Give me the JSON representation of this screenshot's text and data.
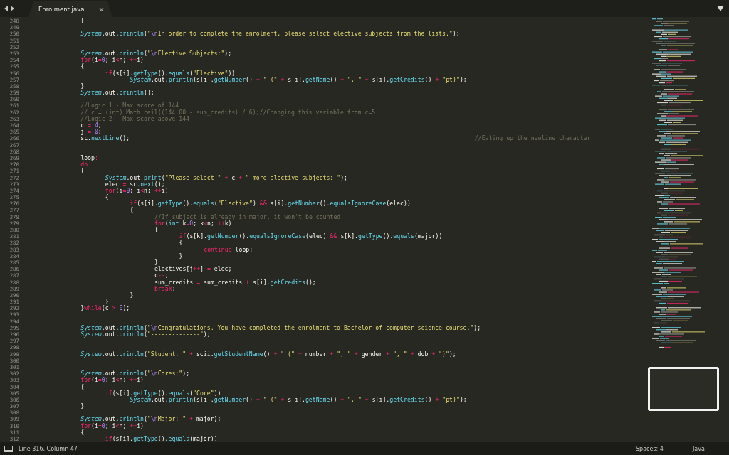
{
  "tab": {
    "title": "Enrolment.java",
    "selected": true
  },
  "lines": [
    {
      "number": "248",
      "tokens": [
        {
          "kind": "txt",
          "text": "\t\t\t\t}"
        }
      ]
    },
    {
      "number": "249"
    },
    {
      "number": "250",
      "tokens": [
        {
          "kind": "cls",
          "text": "\t\t\t\tSystem"
        },
        {
          "kind": "txt",
          "text": ".out."
        },
        {
          "kind": "fn",
          "text": "println"
        },
        {
          "kind": "txt",
          "text": "("
        },
        {
          "kind": "str",
          "text": "\""
        },
        {
          "kind": "esc",
          "text": "\\n"
        },
        {
          "kind": "str",
          "text": "In order to complete the enrolment, please select elective subjects from the lists.\""
        },
        {
          "kind": "txt",
          "text": ");"
        }
      ]
    },
    {
      "number": "251"
    },
    {
      "number": "252"
    },
    {
      "number": "253",
      "tokens": [
        {
          "kind": "cls",
          "text": "\t\t\t\tSystem"
        },
        {
          "kind": "txt",
          "text": ".out."
        },
        {
          "kind": "fn",
          "text": "println"
        },
        {
          "kind": "txt",
          "text": "("
        },
        {
          "kind": "str",
          "text": "\""
        },
        {
          "kind": "esc",
          "text": "\\n"
        },
        {
          "kind": "str",
          "text": "Elective Subjects:\""
        },
        {
          "kind": "txt",
          "text": ");"
        }
      ]
    },
    {
      "number": "254",
      "tokens": [
        {
          "kind": "kw",
          "text": "\t\t\t\tfor"
        },
        {
          "kind": "txt",
          "text": "(i"
        },
        {
          "kind": "kw",
          "text": "="
        },
        {
          "kind": "num",
          "text": "0"
        },
        {
          "kind": "txt",
          "text": "; i"
        },
        {
          "kind": "kw",
          "text": "<"
        },
        {
          "kind": "txt",
          "text": "n; "
        },
        {
          "kind": "kw",
          "text": "++"
        },
        {
          "kind": "txt",
          "text": "i)"
        }
      ]
    },
    {
      "number": "255",
      "tokens": [
        {
          "kind": "txt",
          "text": "\t\t\t\t{"
        }
      ]
    },
    {
      "number": "256",
      "tokens": [
        {
          "kind": "kw",
          "text": "\t\t\t\t\t\tif"
        },
        {
          "kind": "txt",
          "text": "(s[i]."
        },
        {
          "kind": "fn",
          "text": "getType"
        },
        {
          "kind": "txt",
          "text": "()."
        },
        {
          "kind": "fn",
          "text": "equals"
        },
        {
          "kind": "txt",
          "text": "("
        },
        {
          "kind": "str",
          "text": "\"Elective\""
        },
        {
          "kind": "txt",
          "text": "))"
        }
      ]
    },
    {
      "number": "257",
      "tokens": [
        {
          "kind": "cls",
          "text": "\t\t\t\t\t\t\t\tSystem"
        },
        {
          "kind": "txt",
          "text": ".out."
        },
        {
          "kind": "fn",
          "text": "println"
        },
        {
          "kind": "txt",
          "text": "(s[i]."
        },
        {
          "kind": "fn",
          "text": "getNumber"
        },
        {
          "kind": "txt",
          "text": "() "
        },
        {
          "kind": "kw",
          "text": "+"
        },
        {
          "kind": "str",
          "text": " \" (\" "
        },
        {
          "kind": "kw",
          "text": "+"
        },
        {
          "kind": "txt",
          "text": " s[i]."
        },
        {
          "kind": "fn",
          "text": "getName"
        },
        {
          "kind": "txt",
          "text": "() "
        },
        {
          "kind": "kw",
          "text": "+"
        },
        {
          "kind": "str",
          "text": " \", \" "
        },
        {
          "kind": "kw",
          "text": "+"
        },
        {
          "kind": "txt",
          "text": " s[i]."
        },
        {
          "kind": "fn",
          "text": "getCredits"
        },
        {
          "kind": "txt",
          "text": "() "
        },
        {
          "kind": "kw",
          "text": "+"
        },
        {
          "kind": "str",
          "text": " \"pt)\""
        },
        {
          "kind": "txt",
          "text": ");"
        }
      ]
    },
    {
      "number": "258",
      "tokens": [
        {
          "kind": "txt",
          "text": "\t\t\t\t}"
        }
      ]
    },
    {
      "number": "259",
      "tokens": [
        {
          "kind": "cls",
          "text": "\t\t\t\tSystem"
        },
        {
          "kind": "txt",
          "text": ".out."
        },
        {
          "kind": "fn",
          "text": "println"
        },
        {
          "kind": "txt",
          "text": "();"
        }
      ]
    },
    {
      "number": "260"
    },
    {
      "number": "261",
      "tokens": [
        {
          "kind": "cmt",
          "text": "\t\t\t\t//Logic 1 - Max score of 144"
        }
      ]
    },
    {
      "number": "262",
      "tokens": [
        {
          "kind": "cmt",
          "text": "\t\t\t\t// c = (int) Math.ceil((144.00 - sum_credits) / 6);//Changing this variable from c=5"
        }
      ]
    },
    {
      "number": "263",
      "tokens": [
        {
          "kind": "cmt",
          "text": "\t\t\t\t//Logic 2 - Max score above 144"
        }
      ]
    },
    {
      "number": "264",
      "tokens": [
        {
          "kind": "txt",
          "text": "\t\t\t\tc "
        },
        {
          "kind": "kw",
          "text": "="
        },
        {
          "kind": "num",
          "text": " 4"
        },
        {
          "kind": "txt",
          "text": ";"
        }
      ]
    },
    {
      "number": "265",
      "tokens": [
        {
          "kind": "txt",
          "text": "\t\t\t\tj "
        },
        {
          "kind": "kw",
          "text": "="
        },
        {
          "kind": "num",
          "text": " 0"
        },
        {
          "kind": "txt",
          "text": ";"
        }
      ]
    },
    {
      "number": "266",
      "tokens": [
        {
          "kind": "txt",
          "text": "\t\t\t\tsc."
        },
        {
          "kind": "fn",
          "text": "nextLine"
        },
        {
          "kind": "txt",
          "text": "();\t\t\t\t\t\t\t\t\t\t\t\t\t\t\t\t\t\t\t\t\t\t\t\t\t\t\t\t"
        },
        {
          "kind": "cmt",
          "text": "//Eating up the newline character"
        }
      ]
    },
    {
      "number": "267"
    },
    {
      "number": "268"
    },
    {
      "number": "269",
      "tokens": [
        {
          "kind": "txt",
          "text": "\t\t\t\tloop"
        },
        {
          "kind": "kw",
          "text": ":"
        }
      ]
    },
    {
      "number": "270",
      "tokens": [
        {
          "kind": "kw",
          "text": "\t\t\t\tdo"
        }
      ]
    },
    {
      "number": "271",
      "tokens": [
        {
          "kind": "txt",
          "text": "\t\t\t\t{"
        }
      ]
    },
    {
      "number": "272",
      "tokens": [
        {
          "kind": "cls",
          "text": "\t\t\t\t\t\tSystem"
        },
        {
          "kind": "txt",
          "text": ".out."
        },
        {
          "kind": "fn",
          "text": "print"
        },
        {
          "kind": "txt",
          "text": "("
        },
        {
          "kind": "str",
          "text": "\"Please select \" "
        },
        {
          "kind": "kw",
          "text": "+"
        },
        {
          "kind": "txt",
          "text": " c "
        },
        {
          "kind": "kw",
          "text": "+"
        },
        {
          "kind": "str",
          "text": " \" more elective subjects: \""
        },
        {
          "kind": "txt",
          "text": ");"
        }
      ]
    },
    {
      "number": "273",
      "tokens": [
        {
          "kind": "txt",
          "text": "\t\t\t\t\t\telec "
        },
        {
          "kind": "kw",
          "text": "="
        },
        {
          "kind": "txt",
          "text": " sc."
        },
        {
          "kind": "fn",
          "text": "next"
        },
        {
          "kind": "txt",
          "text": "();"
        }
      ]
    },
    {
      "number": "274",
      "tokens": [
        {
          "kind": "kw",
          "text": "\t\t\t\t\t\tfor"
        },
        {
          "kind": "txt",
          "text": "(i"
        },
        {
          "kind": "kw",
          "text": "="
        },
        {
          "kind": "num",
          "text": "0"
        },
        {
          "kind": "txt",
          "text": "; i"
        },
        {
          "kind": "kw",
          "text": "<"
        },
        {
          "kind": "txt",
          "text": "n; "
        },
        {
          "kind": "kw",
          "text": "++"
        },
        {
          "kind": "txt",
          "text": "i)"
        }
      ]
    },
    {
      "number": "275",
      "tokens": [
        {
          "kind": "txt",
          "text": "\t\t\t\t\t\t{"
        }
      ]
    },
    {
      "number": "276",
      "tokens": [
        {
          "kind": "kw",
          "text": "\t\t\t\t\t\t\t\tif"
        },
        {
          "kind": "txt",
          "text": "(s[i]."
        },
        {
          "kind": "fn",
          "text": "getType"
        },
        {
          "kind": "txt",
          "text": "()."
        },
        {
          "kind": "fn",
          "text": "equals"
        },
        {
          "kind": "txt",
          "text": "("
        },
        {
          "kind": "str",
          "text": "\"Elective\""
        },
        {
          "kind": "txt",
          "text": ") "
        },
        {
          "kind": "kw",
          "text": "&&"
        },
        {
          "kind": "txt",
          "text": " s[i]."
        },
        {
          "kind": "fn",
          "text": "getNumber"
        },
        {
          "kind": "txt",
          "text": "()."
        },
        {
          "kind": "fn",
          "text": "equalsIgnoreCase"
        },
        {
          "kind": "txt",
          "text": "(elec))"
        }
      ]
    },
    {
      "number": "277",
      "tokens": [
        {
          "kind": "txt",
          "text": "\t\t\t\t\t\t\t\t{"
        }
      ]
    },
    {
      "number": "278",
      "tokens": [
        {
          "kind": "cmt",
          "text": "\t\t\t\t\t\t\t\t\t\t//If subject is already in major, it won't be counted"
        }
      ]
    },
    {
      "number": "279",
      "tokens": [
        {
          "kind": "kw",
          "text": "\t\t\t\t\t\t\t\t\t\tfor"
        },
        {
          "kind": "txt",
          "text": "("
        },
        {
          "kind": "fn",
          "text": "int"
        },
        {
          "kind": "txt",
          "text": " k"
        },
        {
          "kind": "kw",
          "text": "="
        },
        {
          "kind": "num",
          "text": "0"
        },
        {
          "kind": "txt",
          "text": "; k"
        },
        {
          "kind": "kw",
          "text": "<"
        },
        {
          "kind": "txt",
          "text": "n; "
        },
        {
          "kind": "kw",
          "text": "++"
        },
        {
          "kind": "txt",
          "text": "k)"
        }
      ]
    },
    {
      "number": "280",
      "tokens": [
        {
          "kind": "txt",
          "text": "\t\t\t\t\t\t\t\t\t\t{"
        }
      ]
    },
    {
      "number": "281",
      "tokens": [
        {
          "kind": "kw",
          "text": "\t\t\t\t\t\t\t\t\t\t\t\tif"
        },
        {
          "kind": "txt",
          "text": "(s[k]."
        },
        {
          "kind": "fn",
          "text": "getNumber"
        },
        {
          "kind": "txt",
          "text": "()."
        },
        {
          "kind": "fn",
          "text": "equalsIgnoreCase"
        },
        {
          "kind": "txt",
          "text": "(elec) "
        },
        {
          "kind": "kw",
          "text": "&&"
        },
        {
          "kind": "txt",
          "text": " s[k]."
        },
        {
          "kind": "fn",
          "text": "getType"
        },
        {
          "kind": "txt",
          "text": "()."
        },
        {
          "kind": "fn",
          "text": "equals"
        },
        {
          "kind": "txt",
          "text": "(major))"
        }
      ]
    },
    {
      "number": "282",
      "tokens": [
        {
          "kind": "txt",
          "text": "\t\t\t\t\t\t\t\t\t\t\t\t{"
        }
      ]
    },
    {
      "number": "283",
      "tokens": [
        {
          "kind": "kw",
          "text": "\t\t\t\t\t\t\t\t\t\t\t\t\t\tcontinue"
        },
        {
          "kind": "txt",
          "text": " loop;"
        }
      ]
    },
    {
      "number": "284",
      "tokens": [
        {
          "kind": "txt",
          "text": "\t\t\t\t\t\t\t\t\t\t\t\t}"
        }
      ]
    },
    {
      "number": "285",
      "tokens": [
        {
          "kind": "txt",
          "text": "\t\t\t\t\t\t\t\t\t\t}"
        }
      ]
    },
    {
      "number": "286",
      "tokens": [
        {
          "kind": "txt",
          "text": "\t\t\t\t\t\t\t\t\t\telectives[j"
        },
        {
          "kind": "kw",
          "text": "++"
        },
        {
          "kind": "txt",
          "text": "] "
        },
        {
          "kind": "kw",
          "text": "="
        },
        {
          "kind": "txt",
          "text": " elec;"
        }
      ]
    },
    {
      "number": "287",
      "tokens": [
        {
          "kind": "txt",
          "text": "\t\t\t\t\t\t\t\t\t\tc"
        },
        {
          "kind": "kw",
          "text": "--"
        },
        {
          "kind": "txt",
          "text": ";"
        }
      ]
    },
    {
      "number": "288",
      "tokens": [
        {
          "kind": "txt",
          "text": "\t\t\t\t\t\t\t\t\t\tsum_credits "
        },
        {
          "kind": "kw",
          "text": "="
        },
        {
          "kind": "txt",
          "text": " sum_credits "
        },
        {
          "kind": "kw",
          "text": "+"
        },
        {
          "kind": "txt",
          "text": " s[i]."
        },
        {
          "kind": "fn",
          "text": "getCredits"
        },
        {
          "kind": "txt",
          "text": "();"
        }
      ]
    },
    {
      "number": "289",
      "tokens": [
        {
          "kind": "kw",
          "text": "\t\t\t\t\t\t\t\t\t\tbreak"
        },
        {
          "kind": "txt",
          "text": ";"
        }
      ]
    },
    {
      "number": "290",
      "tokens": [
        {
          "kind": "txt",
          "text": "\t\t\t\t\t\t\t\t}"
        }
      ]
    },
    {
      "number": "291",
      "tokens": [
        {
          "kind": "txt",
          "text": "\t\t\t\t\t\t}"
        }
      ]
    },
    {
      "number": "292",
      "tokens": [
        {
          "kind": "txt",
          "text": "\t\t\t\t}"
        },
        {
          "kind": "kw",
          "text": "while"
        },
        {
          "kind": "txt",
          "text": "(c "
        },
        {
          "kind": "kw",
          "text": ">"
        },
        {
          "kind": "num",
          "text": " 0"
        },
        {
          "kind": "txt",
          "text": ");"
        }
      ]
    },
    {
      "number": "293"
    },
    {
      "number": "294"
    },
    {
      "number": "295",
      "tokens": [
        {
          "kind": "cls",
          "text": "\t\t\t\tSystem"
        },
        {
          "kind": "txt",
          "text": ".out."
        },
        {
          "kind": "fn",
          "text": "println"
        },
        {
          "kind": "txt",
          "text": "("
        },
        {
          "kind": "str",
          "text": "\""
        },
        {
          "kind": "esc",
          "text": "\\n"
        },
        {
          "kind": "str",
          "text": "Congratulations. You have completed the enrolment to Bachelor of computer science course.\""
        },
        {
          "kind": "txt",
          "text": ");"
        }
      ]
    },
    {
      "number": "296",
      "tokens": [
        {
          "kind": "cls",
          "text": "\t\t\t\tSystem"
        },
        {
          "kind": "txt",
          "text": ".out."
        },
        {
          "kind": "fn",
          "text": "println"
        },
        {
          "kind": "txt",
          "text": "("
        },
        {
          "kind": "str",
          "text": "\"--------------\""
        },
        {
          "kind": "txt",
          "text": ");"
        }
      ]
    },
    {
      "number": "297"
    },
    {
      "number": "298"
    },
    {
      "number": "299",
      "tokens": [
        {
          "kind": "cls",
          "text": "\t\t\t\tSystem"
        },
        {
          "kind": "txt",
          "text": ".out."
        },
        {
          "kind": "fn",
          "text": "println"
        },
        {
          "kind": "txt",
          "text": "("
        },
        {
          "kind": "str",
          "text": "\"Student: \" "
        },
        {
          "kind": "kw",
          "text": "+"
        },
        {
          "kind": "txt",
          "text": " scii."
        },
        {
          "kind": "fn",
          "text": "getStudentName"
        },
        {
          "kind": "txt",
          "text": "() "
        },
        {
          "kind": "kw",
          "text": "+"
        },
        {
          "kind": "str",
          "text": " \" (\" "
        },
        {
          "kind": "kw",
          "text": "+"
        },
        {
          "kind": "txt",
          "text": " number "
        },
        {
          "kind": "kw",
          "text": "+"
        },
        {
          "kind": "str",
          "text": " \", \" "
        },
        {
          "kind": "kw",
          "text": "+"
        },
        {
          "kind": "txt",
          "text": " gender "
        },
        {
          "kind": "kw",
          "text": "+"
        },
        {
          "kind": "str",
          "text": " \", \" "
        },
        {
          "kind": "kw",
          "text": "+"
        },
        {
          "kind": "txt",
          "text": " dob "
        },
        {
          "kind": "kw",
          "text": "+"
        },
        {
          "kind": "str",
          "text": " \")\""
        },
        {
          "kind": "txt",
          "text": ");"
        }
      ]
    },
    {
      "number": "300"
    },
    {
      "number": "301"
    },
    {
      "number": "302",
      "tokens": [
        {
          "kind": "cls",
          "text": "\t\t\t\tSystem"
        },
        {
          "kind": "txt",
          "text": ".out."
        },
        {
          "kind": "fn",
          "text": "println"
        },
        {
          "kind": "txt",
          "text": "("
        },
        {
          "kind": "str",
          "text": "\""
        },
        {
          "kind": "esc",
          "text": "\\n"
        },
        {
          "kind": "str",
          "text": "Cores:\""
        },
        {
          "kind": "txt",
          "text": ");"
        }
      ]
    },
    {
      "number": "303",
      "tokens": [
        {
          "kind": "kw",
          "text": "\t\t\t\tfor"
        },
        {
          "kind": "txt",
          "text": "(i"
        },
        {
          "kind": "kw",
          "text": "="
        },
        {
          "kind": "num",
          "text": "0"
        },
        {
          "kind": "txt",
          "text": "; i"
        },
        {
          "kind": "kw",
          "text": "<"
        },
        {
          "kind": "txt",
          "text": "n; "
        },
        {
          "kind": "kw",
          "text": "++"
        },
        {
          "kind": "txt",
          "text": "i)"
        }
      ]
    },
    {
      "number": "304",
      "tokens": [
        {
          "kind": "txt",
          "text": "\t\t\t\t{"
        }
      ]
    },
    {
      "number": "305",
      "tokens": [
        {
          "kind": "kw",
          "text": "\t\t\t\t\t\tif"
        },
        {
          "kind": "txt",
          "text": "(s[i]."
        },
        {
          "kind": "fn",
          "text": "getType"
        },
        {
          "kind": "txt",
          "text": "()."
        },
        {
          "kind": "fn",
          "text": "equals"
        },
        {
          "kind": "txt",
          "text": "("
        },
        {
          "kind": "str",
          "text": "\"Core\""
        },
        {
          "kind": "txt",
          "text": "))"
        }
      ]
    },
    {
      "number": "306",
      "tokens": [
        {
          "kind": "cls",
          "text": "\t\t\t\t\t\t\t\tSystem"
        },
        {
          "kind": "txt",
          "text": ".out."
        },
        {
          "kind": "fn",
          "text": "println"
        },
        {
          "kind": "txt",
          "text": "(s[i]."
        },
        {
          "kind": "fn",
          "text": "getNumber"
        },
        {
          "kind": "txt",
          "text": "() "
        },
        {
          "kind": "kw",
          "text": "+"
        },
        {
          "kind": "str",
          "text": " \" (\" "
        },
        {
          "kind": "kw",
          "text": "+"
        },
        {
          "kind": "txt",
          "text": " s[i]."
        },
        {
          "kind": "fn",
          "text": "getName"
        },
        {
          "kind": "txt",
          "text": "() "
        },
        {
          "kind": "kw",
          "text": "+"
        },
        {
          "kind": "str",
          "text": " \", \" "
        },
        {
          "kind": "kw",
          "text": "+"
        },
        {
          "kind": "txt",
          "text": " s[i]."
        },
        {
          "kind": "fn",
          "text": "getCredits"
        },
        {
          "kind": "txt",
          "text": "() "
        },
        {
          "kind": "kw",
          "text": "+"
        },
        {
          "kind": "str",
          "text": " \"pt)\""
        },
        {
          "kind": "txt",
          "text": ");"
        }
      ]
    },
    {
      "number": "307",
      "tokens": [
        {
          "kind": "txt",
          "text": "\t\t\t\t}"
        }
      ]
    },
    {
      "number": "308"
    },
    {
      "number": "309",
      "tokens": [
        {
          "kind": "cls",
          "text": "\t\t\t\tSystem"
        },
        {
          "kind": "txt",
          "text": ".out."
        },
        {
          "kind": "fn",
          "text": "println"
        },
        {
          "kind": "txt",
          "text": "("
        },
        {
          "kind": "str",
          "text": "\""
        },
        {
          "kind": "esc",
          "text": "\\n"
        },
        {
          "kind": "str",
          "text": "Major: \" "
        },
        {
          "kind": "kw",
          "text": "+"
        },
        {
          "kind": "txt",
          "text": " major);"
        }
      ]
    },
    {
      "number": "310",
      "tokens": [
        {
          "kind": "kw",
          "text": "\t\t\t\tfor"
        },
        {
          "kind": "txt",
          "text": "(i"
        },
        {
          "kind": "kw",
          "text": "="
        },
        {
          "kind": "num",
          "text": "0"
        },
        {
          "kind": "txt",
          "text": "; i"
        },
        {
          "kind": "kw",
          "text": "<"
        },
        {
          "kind": "txt",
          "text": "n; "
        },
        {
          "kind": "kw",
          "text": "++"
        },
        {
          "kind": "txt",
          "text": "i)"
        }
      ]
    },
    {
      "number": "311",
      "tokens": [
        {
          "kind": "txt",
          "text": "\t\t\t\t{"
        }
      ]
    },
    {
      "number": "312",
      "tokens": [
        {
          "kind": "kw",
          "text": "\t\t\t\t\t\tif"
        },
        {
          "kind": "txt",
          "text": "(s[i]."
        },
        {
          "kind": "fn",
          "text": "getType"
        },
        {
          "kind": "txt",
          "text": "()."
        },
        {
          "kind": "fn",
          "text": "equals"
        },
        {
          "kind": "txt",
          "text": "(major))"
        }
      ]
    }
  ],
  "status_bar": {
    "position": "Line 316, Column 47",
    "indentation": "Spaces: 4",
    "syntax": "Java"
  }
}
